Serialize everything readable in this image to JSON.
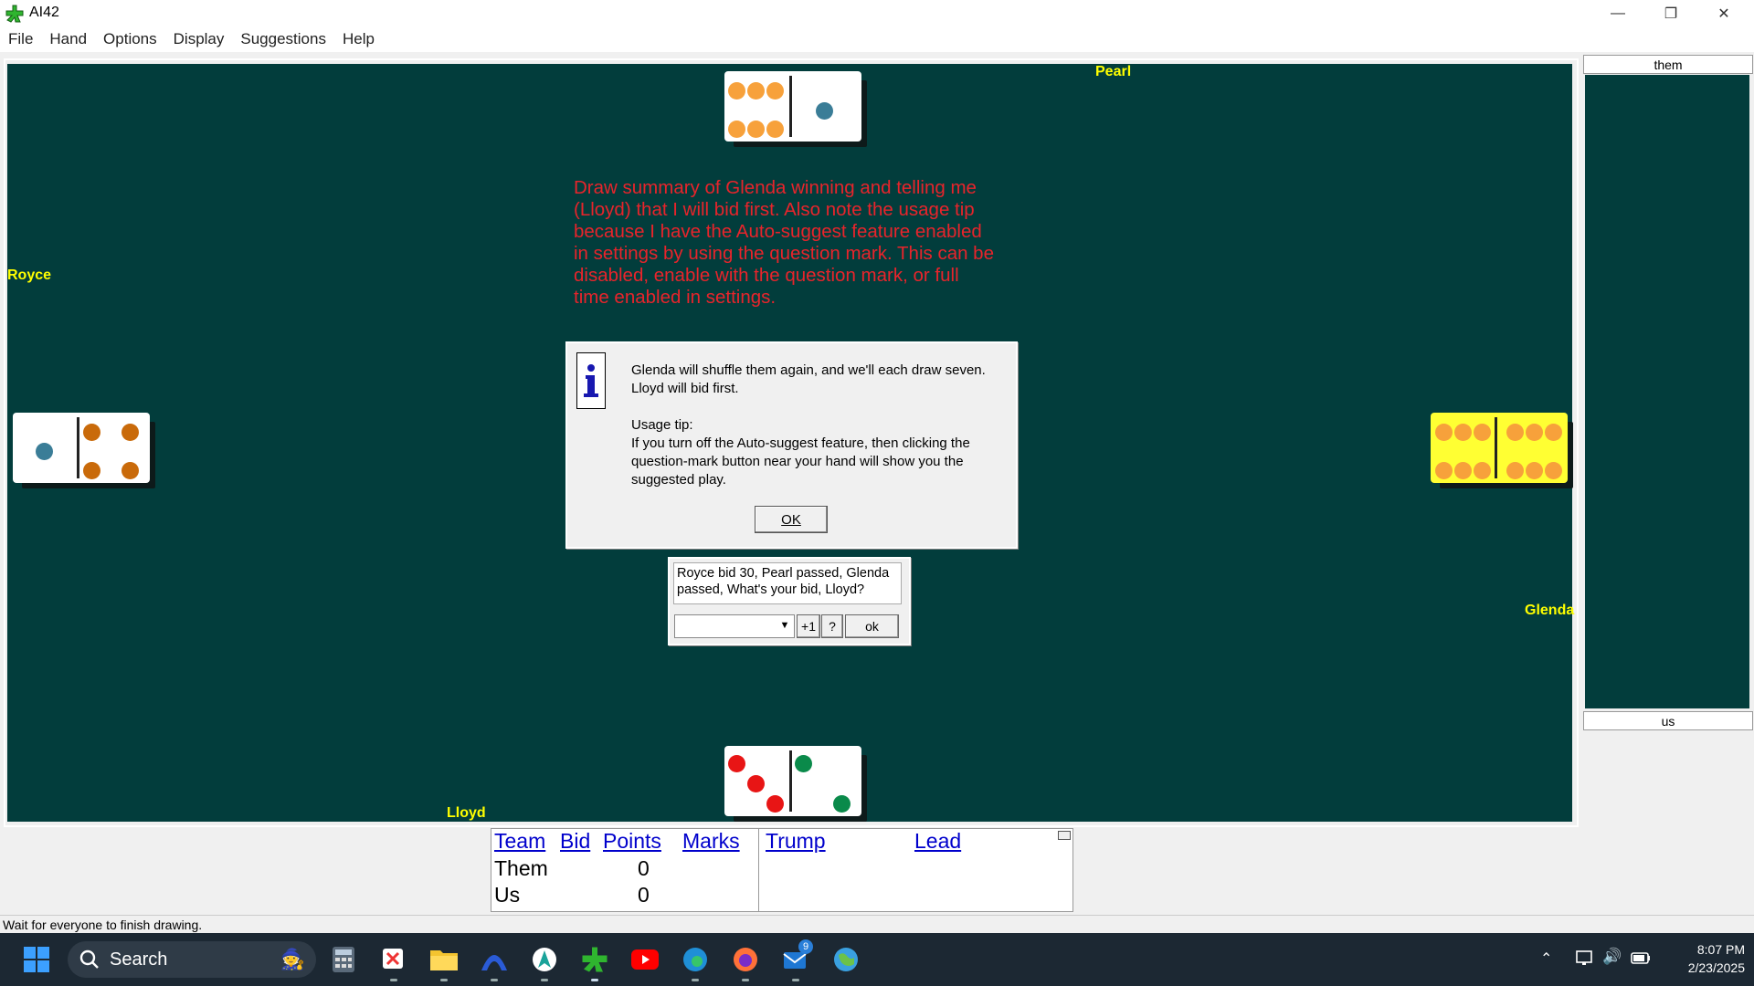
{
  "window": {
    "title": "AI42"
  },
  "menu": [
    "File",
    "Hand",
    "Options",
    "Display",
    "Suggestions",
    "Help"
  ],
  "players": {
    "top": "Pearl",
    "left": "Royce",
    "right": "Glenda",
    "bottom": "Lloyd"
  },
  "dominoes": {
    "top": {
      "left_pips": 6,
      "right_pips": 1
    },
    "left": {
      "left_pips": 1,
      "right_pips": 4
    },
    "right": {
      "left_pips": 6,
      "right_pips": 6
    },
    "bottom": {
      "left_pips": 3,
      "right_pips": 2
    }
  },
  "note": "Draw summary of Glenda winning and telling me (Lloyd) that I will bid first. Also note the usage tip because I have the Auto-suggest feature enabled in settings by using the question mark. This can be disabled, enable with the question mark, or full time enabled in settings.",
  "dialog": {
    "message": "Glenda will shuffle them again, and we'll each draw seven. Lloyd will bid first.",
    "tip_title": "Usage tip:",
    "tip_body": "If you turn off the Auto-suggest feature, then clicking the question-mark button near your hand will show you the suggested play.",
    "ok_label": "OK"
  },
  "bid": {
    "message": "Royce bid  30, Pearl passed, Glenda passed, What's your bid, Lloyd?",
    "selected": "",
    "plus_label": "+1",
    "help_label": "?",
    "ok_label": "ok"
  },
  "panel": {
    "top_label": "them",
    "bottom_label": "us"
  },
  "score": {
    "headers": [
      "Team",
      "Bid",
      "Points",
      "Marks",
      "Trump",
      "Lead"
    ],
    "rows": [
      {
        "team": "Them",
        "points": "0"
      },
      {
        "team": "Us",
        "points": "0"
      }
    ]
  },
  "status": "Wait for everyone to finish drawing.",
  "taskbar": {
    "search_label": "Search",
    "badge": "9",
    "time": "8:07 PM",
    "date": "2/23/2025"
  },
  "colors": {
    "felt": "#023d3c",
    "player_name": "#ffff00",
    "note_red": "#e8242b",
    "pip_orange": "#f7a13b",
    "pip_brown": "#c96a0a",
    "pip_blue": "#3a7d97",
    "pip_red": "#e81515",
    "pip_green": "#0a8a4a",
    "yellow_domino": "#ffff33"
  }
}
